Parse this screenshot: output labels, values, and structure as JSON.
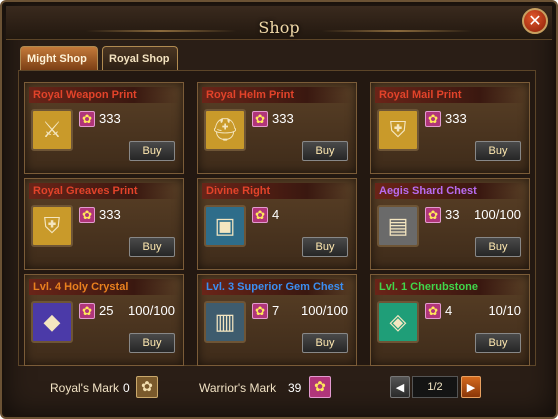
{
  "window": {
    "title": "Shop",
    "close_glyph": "✕"
  },
  "tabs": [
    {
      "label": "Might Shop",
      "active": true
    },
    {
      "label": "Royal Shop",
      "active": false
    }
  ],
  "items": [
    {
      "name": "Royal Weapon Print",
      "name_color": "#e2432a",
      "icon": "scroll-sword-icon",
      "cost": "333",
      "stock": "",
      "buy_label": "Buy"
    },
    {
      "name": "Royal Helm Print",
      "name_color": "#e2432a",
      "icon": "scroll-helm-icon",
      "cost": "333",
      "stock": "",
      "buy_label": "Buy"
    },
    {
      "name": "Royal Mail Print",
      "name_color": "#e2432a",
      "icon": "scroll-armor-icon",
      "cost": "333",
      "stock": "",
      "buy_label": "Buy"
    },
    {
      "name": "Royal Greaves Print",
      "name_color": "#e2432a",
      "icon": "scroll-greaves-icon",
      "cost": "333",
      "stock": "",
      "buy_label": "Buy"
    },
    {
      "name": "Divine Right",
      "name_color": "#e2432a",
      "icon": "treasure-chest-icon",
      "cost": "4",
      "stock": "",
      "buy_label": "Buy"
    },
    {
      "name": "Aegis Shard Chest",
      "name_color": "#b86bf0",
      "icon": "silver-chest-icon",
      "cost": "33",
      "stock": "100/100",
      "buy_label": "Buy"
    },
    {
      "name": "Lvl. 4 Holy Crystal",
      "name_color": "#e9801e",
      "icon": "purple-crystal-icon",
      "cost": "25",
      "stock": "100/100",
      "buy_label": "Buy"
    },
    {
      "name": "Lvl. 3 Superior Gem Chest",
      "name_color": "#3b8ef2",
      "icon": "gem-chest-icon",
      "cost": "7",
      "stock": "100/100",
      "buy_label": "Buy"
    },
    {
      "name": "Lvl. 1 Cherubstone",
      "name_color": "#41d64a",
      "icon": "green-gem-icon",
      "cost": "4",
      "stock": "10/10",
      "buy_label": "Buy"
    }
  ],
  "footer": {
    "royals_mark_label": "Royal's Mark",
    "royals_mark_value": "0",
    "warriors_mark_label": "Warrior's Mark",
    "warriors_mark_value": "39",
    "page": "1/2"
  }
}
